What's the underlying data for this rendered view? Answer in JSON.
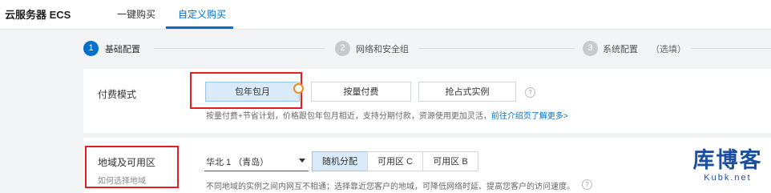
{
  "header": {
    "app_title": "云服务器 ECS",
    "tabs": [
      {
        "label": "一键购买",
        "active": false
      },
      {
        "label": "自定义购买",
        "active": true
      }
    ]
  },
  "stepper": {
    "steps": [
      {
        "number": "1",
        "label": "基础配置",
        "active": true
      },
      {
        "number": "2",
        "label": "网络和安全组",
        "active": false
      },
      {
        "number": "3",
        "label": "系统配置",
        "suffix": "（选填）",
        "active": false
      }
    ]
  },
  "billing": {
    "label": "付费模式",
    "options": [
      {
        "label": "包年包月",
        "selected": true
      },
      {
        "label": "按量付费",
        "selected": false
      },
      {
        "label": "抢占式实例",
        "selected": false
      }
    ],
    "help_icon": "question-icon",
    "description": "按量付费+节省计划，价格跟包年包月相近，支持分期付款，资源使用更加灵活，",
    "link": "前往介绍页了解更多>"
  },
  "region": {
    "label": "地域及可用区",
    "sublabel": "如何选择地域",
    "selected_region": "华北 1 （青岛）",
    "zones": [
      {
        "label": "随机分配",
        "selected": true
      },
      {
        "label": "可用区 C",
        "selected": false
      },
      {
        "label": "可用区 B",
        "selected": false
      }
    ],
    "description": "不同地域的实例之间内网互不相通；选择靠近您客户的地域，可降低网络时延、提高您客户的访问速度。",
    "help_icon": "question-icon"
  },
  "watermark": {
    "cn": "库博客",
    "en": "Kubk.net"
  },
  "colors": {
    "accent": "#0070cc",
    "highlight": "#e02020",
    "selected_bg": "#d9ebfa"
  }
}
